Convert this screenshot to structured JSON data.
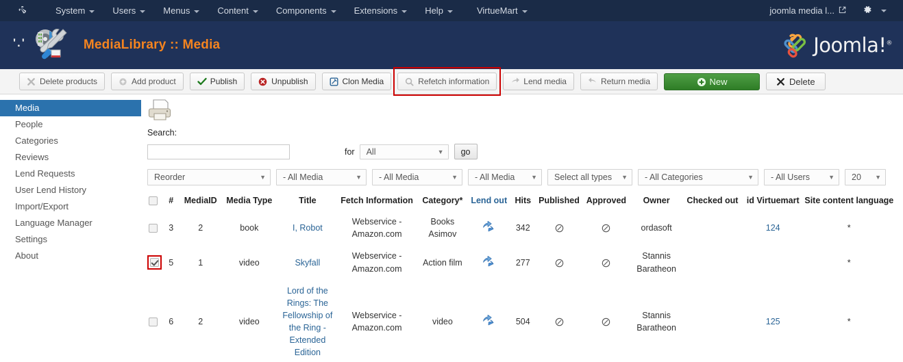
{
  "adminbar": {
    "brand_icon": "joomla-logo-icon",
    "menus": [
      {
        "label": "System"
      },
      {
        "label": "Users"
      },
      {
        "label": "Menus"
      },
      {
        "label": "Content"
      },
      {
        "label": "Components"
      },
      {
        "label": "Extensions"
      },
      {
        "label": "Help"
      },
      {
        "label": "VirtueMart"
      }
    ],
    "site_name": "joomla media l...",
    "external_link_icon": "external-link-icon",
    "gear_icon": "gear-icon"
  },
  "header": {
    "dots": "'.'",
    "tools_icon": "tools-icon",
    "title": "MediaLibrary :: Media",
    "logo_text": "Joomla!",
    "logo_sup": "®",
    "title_color": "#f5841f",
    "bg_color": "#1f3259"
  },
  "toolbar": {
    "buttons": [
      {
        "label": "Delete products",
        "icon": "delete-icon",
        "style": "default"
      },
      {
        "label": "Add product",
        "icon": "add-icon",
        "style": "default"
      },
      {
        "label": "Publish",
        "icon": "check-icon",
        "style": "default"
      },
      {
        "label": "Unpublish",
        "icon": "unpublish-icon",
        "style": "default"
      },
      {
        "label": "Clon Media",
        "icon": "clone-icon",
        "style": "default"
      },
      {
        "label": "Refetch information",
        "icon": "refetch-icon",
        "style": "default",
        "highlighted": true
      },
      {
        "label": "Lend media",
        "icon": "lend-icon",
        "style": "default"
      },
      {
        "label": "Return media",
        "icon": "return-icon",
        "style": "default"
      },
      {
        "label": "New",
        "icon": "plus-circle-icon",
        "style": "green"
      },
      {
        "label": "Delete",
        "icon": "x-icon",
        "style": "default"
      }
    ],
    "highlight_color": "#cc0000"
  },
  "sidebar": {
    "items": [
      {
        "label": "Media",
        "active": true
      },
      {
        "label": "People",
        "active": false
      },
      {
        "label": "Categories",
        "active": false
      },
      {
        "label": "Reviews",
        "active": false
      },
      {
        "label": "Lend Requests",
        "active": false
      },
      {
        "label": "User Lend History",
        "active": false
      },
      {
        "label": "Import/Export",
        "active": false
      },
      {
        "label": "Language Manager",
        "active": false
      },
      {
        "label": "Settings",
        "active": false
      },
      {
        "label": "About",
        "active": false
      }
    ],
    "active_color": "#2b72ad"
  },
  "search": {
    "print_icon": "printer-icon",
    "label": "Search:",
    "value": "",
    "placeholder": "",
    "for_label": "for",
    "scope_value": "All",
    "go_label": "go"
  },
  "filters": [
    {
      "name": "reorder",
      "value": "Reorder"
    },
    {
      "name": "media-1",
      "value": "- All Media"
    },
    {
      "name": "media-2",
      "value": "- All Media"
    },
    {
      "name": "media-3",
      "value": "- All Media"
    },
    {
      "name": "types",
      "value": "Select all types"
    },
    {
      "name": "categories",
      "value": "- All Categories"
    },
    {
      "name": "users",
      "value": "- All Users"
    },
    {
      "name": "limit",
      "value": "20"
    }
  ],
  "table": {
    "columns": [
      {
        "key": "checkbox",
        "label": ""
      },
      {
        "key": "num",
        "label": "#"
      },
      {
        "key": "mediaid",
        "label": "MediaID"
      },
      {
        "key": "mediatype",
        "label": "Media Type"
      },
      {
        "key": "title",
        "label": "Title"
      },
      {
        "key": "fetch",
        "label": "Fetch Information"
      },
      {
        "key": "category",
        "label": "Category*"
      },
      {
        "key": "lendout",
        "label": "Lend out",
        "is_link": true
      },
      {
        "key": "hits",
        "label": "Hits"
      },
      {
        "key": "published",
        "label": "Published"
      },
      {
        "key": "approved",
        "label": "Approved"
      },
      {
        "key": "owner",
        "label": "Owner"
      },
      {
        "key": "checkedout",
        "label": "Checked out"
      },
      {
        "key": "idvirtuemart",
        "label": "id Virtuemart"
      },
      {
        "key": "language",
        "label": "Site content language"
      }
    ],
    "rows": [
      {
        "checked": false,
        "checkbox_highlighted": false,
        "num": "3",
        "mediaid": "2",
        "mediatype": "book",
        "title": "I, Robot",
        "fetch": "Webservice - Amazon.com",
        "category": "Books Asimov",
        "lendout_icon": "lend-arrow-icon",
        "hits": "342",
        "published_icon": "unpublished-circle-icon",
        "approved_icon": "unpublished-circle-icon",
        "owner": "ordasoft",
        "checkedout": "",
        "idvirtuemart": "124",
        "language": "*"
      },
      {
        "checked": true,
        "checkbox_highlighted": true,
        "num": "5",
        "mediaid": "1",
        "mediatype": "video",
        "title": "Skyfall",
        "fetch": "Webservice - Amazon.com",
        "category": "Action film",
        "lendout_icon": "lend-arrow-icon",
        "hits": "277",
        "published_icon": "unpublished-circle-icon",
        "approved_icon": "unpublished-circle-icon",
        "owner": "Stannis Baratheon",
        "checkedout": "",
        "idvirtuemart": "",
        "language": "*"
      },
      {
        "checked": false,
        "checkbox_highlighted": false,
        "num": "6",
        "mediaid": "2",
        "mediatype": "video",
        "title": "Lord of the Rings: The Fellowship of the Ring - Extended Edition",
        "fetch": "Webservice - Amazon.com",
        "category": "video",
        "lendout_icon": "lend-arrow-icon",
        "hits": "504",
        "published_icon": "unpublished-circle-icon",
        "approved_icon": "unpublished-circle-icon",
        "owner": "Stannis Baratheon",
        "checkedout": "",
        "idvirtuemart": "125",
        "language": "*"
      }
    ]
  }
}
